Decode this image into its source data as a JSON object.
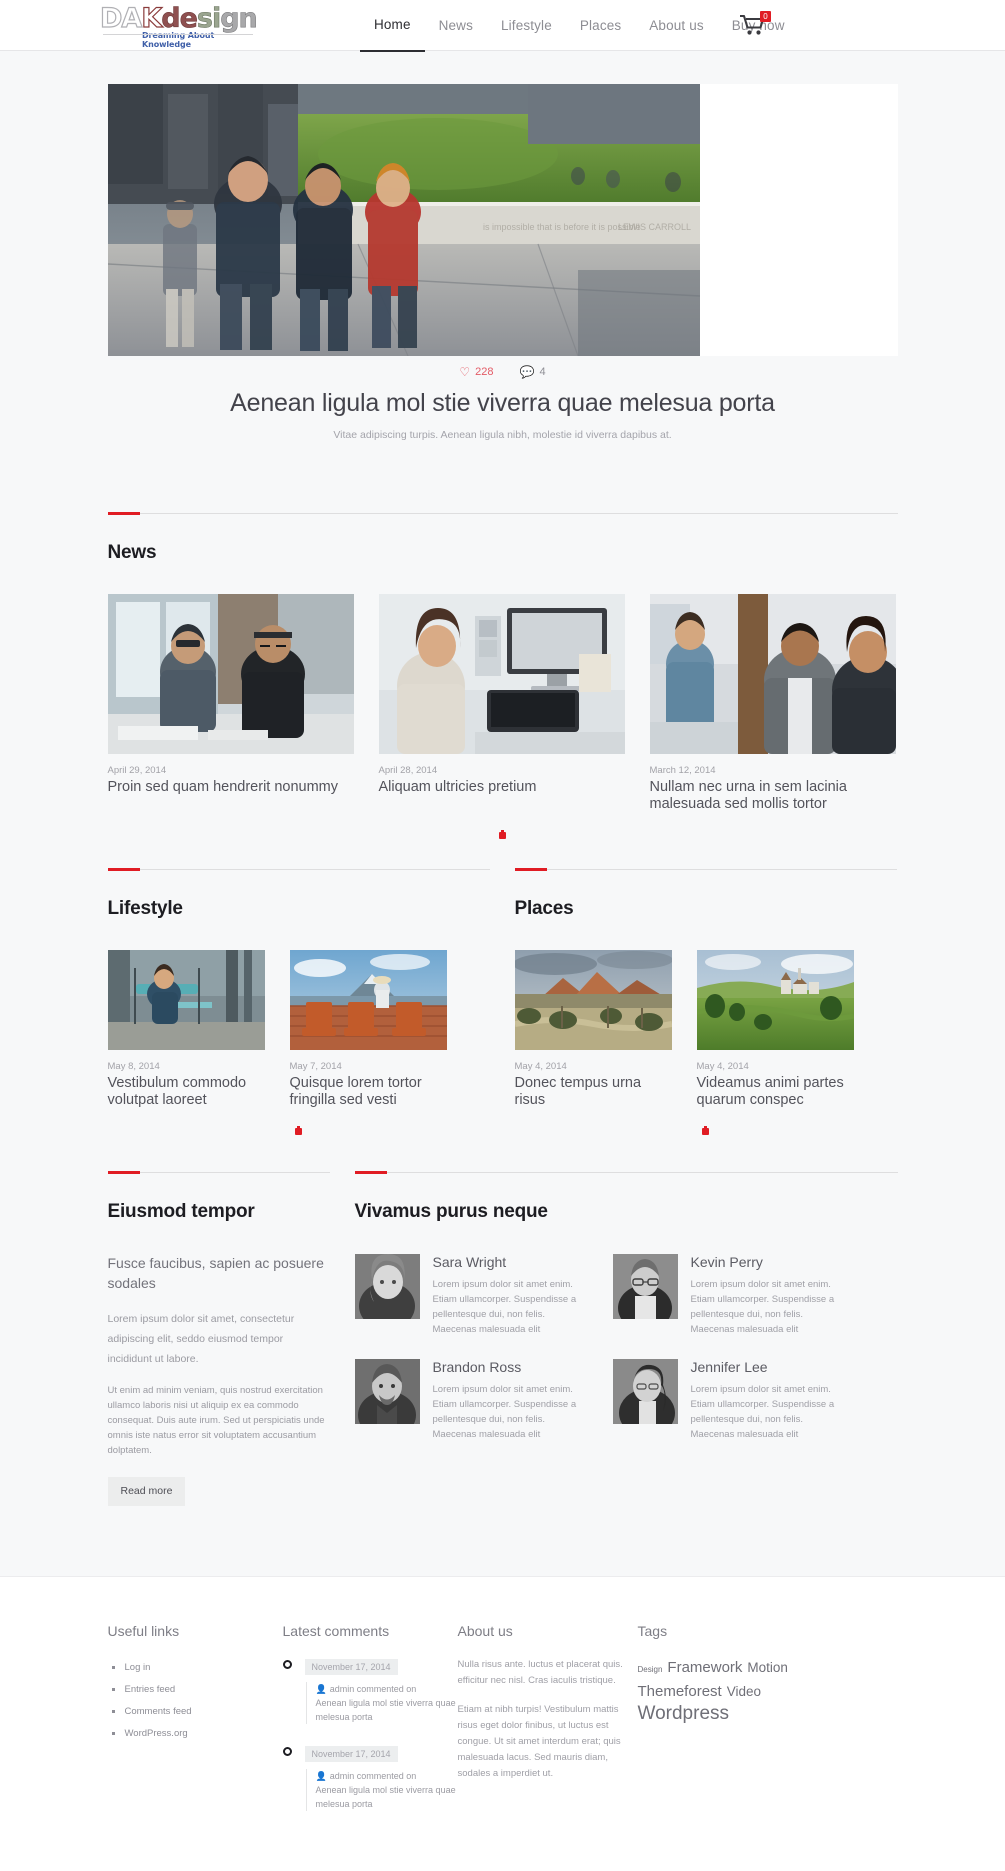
{
  "header": {
    "logo_main": "DAKdesign",
    "logo_parts": {
      "d": "D",
      "a": "A",
      "k": "K",
      "de": "de",
      "si": "si",
      "gn": "gn"
    },
    "logo_tagline": "Dreaming About Knowledge",
    "nav": [
      {
        "label": "Home",
        "active": true
      },
      {
        "label": "News",
        "active": false
      },
      {
        "label": "Lifestyle",
        "active": false
      },
      {
        "label": "Places",
        "active": false
      },
      {
        "label": "About us",
        "active": false
      },
      {
        "label": "Buy now",
        "active": false
      }
    ],
    "cart": {
      "icon": "shopping-cart-icon",
      "count": "0",
      "badge_color": "#e01c24"
    }
  },
  "hero": {
    "likes": "228",
    "comments": "4",
    "title": "Aenean ligula mol stie viverra quae melesua porta",
    "subtitle": "Vitae adipiscing turpis. Aenean ligula nibh, molestie id viverra dapibus at."
  },
  "news": {
    "section_title": "News",
    "items": [
      {
        "date": "April 29, 2014",
        "title": "Proin sed quam hendrerit nonummy"
      },
      {
        "date": "April 28, 2014",
        "title": "Aliquam ultricies pretium"
      },
      {
        "date": "March 12, 2014",
        "title": "Nullam nec urna in sem lacinia malesuada sed mollis tortor"
      }
    ]
  },
  "lifestyle": {
    "section_title": "Lifestyle",
    "items": [
      {
        "date": "May 8, 2014",
        "title": "Vestibulum commodo volutpat laoreet"
      },
      {
        "date": "May 7, 2014",
        "title": "Quisque lorem tortor fringilla sed vesti"
      }
    ]
  },
  "places": {
    "section_title": "Places",
    "items": [
      {
        "date": "May 4, 2014",
        "title": "Donec tempus urna risus"
      },
      {
        "date": "May 4, 2014",
        "title": "Videamus animi partes quarum conspec"
      }
    ]
  },
  "eiusmod": {
    "section_title": "Eiusmod tempor",
    "lead": "Fusce faucibus, sapien ac posuere sodales",
    "paragraph1": "Lorem ipsum dolor sit amet, consectetur adipiscing elit, seddo eiusmod tempor incididunt ut labore.",
    "paragraph2": "Ut enim ad minim veniam, quis nostrud exercitation ullamco laboris nisi ut aliquip ex ea commodo consequat. Duis aute irum. Sed ut perspiciatis unde omnis iste natus error sit voluptatem accusantium dolptatem.",
    "read_more": "Read more"
  },
  "vivamus": {
    "section_title": "Vivamus purus neque",
    "bio": "Lorem ipsum dolor sit amet enim. Etiam ullamcorper. Suspendisse a pellentesque dui, non felis. Maecenas malesuada elit",
    "people": [
      {
        "name": "Sara Wright"
      },
      {
        "name": "Kevin Perry"
      },
      {
        "name": "Brandon Ross"
      },
      {
        "name": "Jennifer Lee"
      }
    ]
  },
  "footer": {
    "useful_links": {
      "title": "Useful links",
      "items": [
        "Log in",
        "Entries feed",
        "Comments feed",
        "WordPress.org"
      ]
    },
    "latest_comments": {
      "title": "Latest comments",
      "items": [
        {
          "date": "November 17, 2014",
          "author": "admin",
          "action": "commented on",
          "post": "Aenean ligula mol stie viverra quae melesua porta"
        },
        {
          "date": "November 17, 2014",
          "author": "admin",
          "action": "commented on",
          "post": "Aenean ligula mol stie viverra quae melesua porta"
        }
      ]
    },
    "about_us": {
      "title": "About us",
      "paragraph1": "Nulla risus ante. luctus et placerat quis. efficitur nec nisl. Cras iaculis tristique.",
      "paragraph2": "Etiam at nibh turpis! Vestibulum mattis risus eget dolor finibus, ut luctus est congue. Ut sit amet interdum erat; quis malesuada lacus. Sed mauris diam, sodales a imperdiet ut."
    },
    "tags": {
      "title": "Tags",
      "items": [
        {
          "label": "Design",
          "size": "tg-xs"
        },
        {
          "label": "Framework",
          "size": "tg-l"
        },
        {
          "label": "Motion",
          "size": "tg-m"
        },
        {
          "label": "Themeforest",
          "size": "tg-l"
        },
        {
          "label": "Video",
          "size": "tg-m"
        },
        {
          "label": "Wordpress",
          "size": "tg-xl"
        }
      ]
    }
  }
}
